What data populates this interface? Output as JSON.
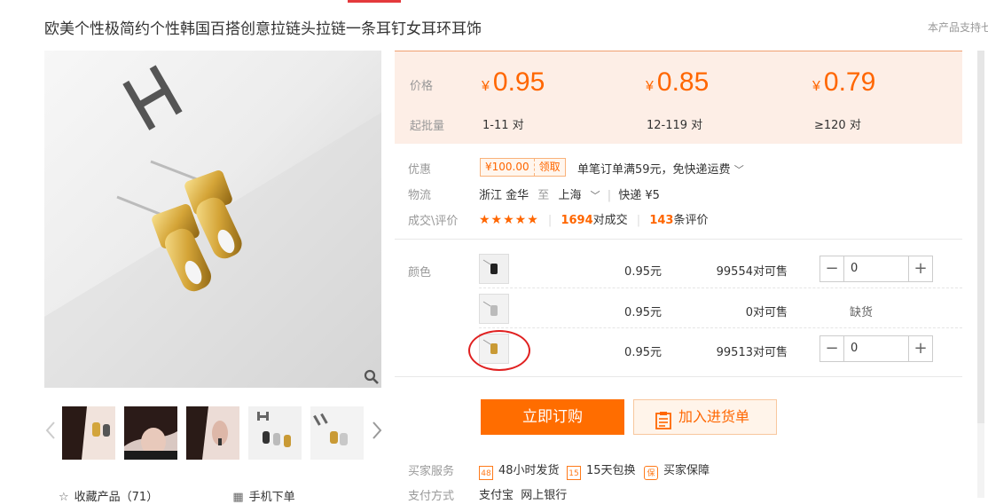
{
  "product": {
    "title": "欧美个性极简约个性韩国百搭创意拉链头拉链一条耳钉女耳环耳饰",
    "note": "本产品支持七"
  },
  "gallery": {
    "thumbs": [
      "thumb-1",
      "thumb-2",
      "thumb-3",
      "thumb-4",
      "thumb-5"
    ]
  },
  "bottom": {
    "favorite": "收藏产品（71）",
    "mobile": "手机下单"
  },
  "pricing": {
    "price_label": "价格",
    "moq_label": "起批量",
    "currency": "¥",
    "tiers": [
      {
        "price": "0.95",
        "qty": "1-11 对"
      },
      {
        "price": "0.85",
        "qty": "12-119 对"
      },
      {
        "price": "0.79",
        "qty": "≥120 对"
      }
    ]
  },
  "promo": {
    "label": "优惠",
    "coupon_amount": "¥100.00",
    "coupon_action": "领取",
    "text": "单笔订单满59元，免快递运费"
  },
  "logistics": {
    "label": "物流",
    "from": "浙江 金华",
    "to_word": "至",
    "to": "上海",
    "method": "快递 ¥5"
  },
  "reviews": {
    "label": "成交\\评价",
    "stars": "★★★★★",
    "deals": "1694",
    "deals_suffix": "对成交",
    "count": "143",
    "count_suffix": "条评价"
  },
  "sku": {
    "label": "颜色",
    "rows": [
      {
        "price": "0.95元",
        "stock": "99554对可售",
        "qty": "0",
        "available": true
      },
      {
        "price": "0.95元",
        "stock": "0对可售",
        "qty": "",
        "available": false,
        "status": "缺货"
      },
      {
        "price": "0.95元",
        "stock": "99513对可售",
        "qty": "0",
        "available": true
      }
    ]
  },
  "actions": {
    "buy": "立即订购",
    "cart": "加入进货单"
  },
  "services": {
    "label": "买家服务",
    "items": [
      "48小时发货",
      "15天包换",
      "买家保障"
    ],
    "icons": [
      "48",
      "15",
      "保"
    ]
  },
  "payment": {
    "label": "支付方式",
    "methods": "支付宝  网上银行"
  },
  "colors": {
    "accent": "#ff6600",
    "price_bg": "#fdeee6",
    "highlight": "#e02020"
  }
}
